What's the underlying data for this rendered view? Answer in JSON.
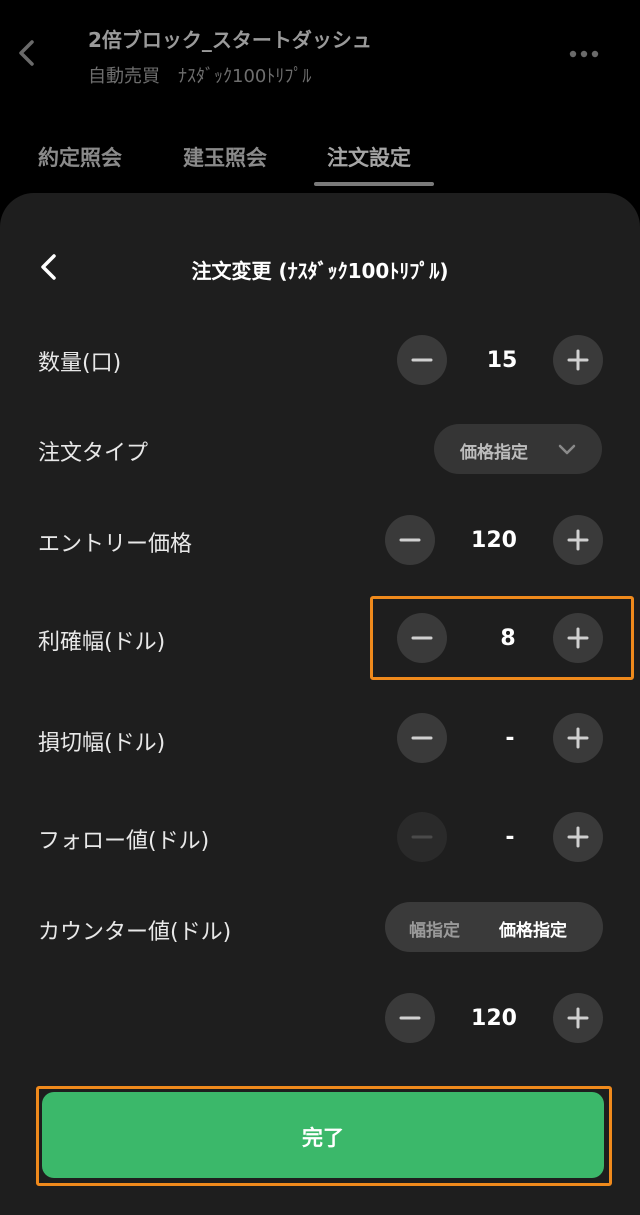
{
  "header": {
    "title": "2倍ブロック_スタートダッシュ",
    "subtitle": "自動売買　ﾅｽﾀﾞｯｸ100ﾄﾘﾌﾟﾙ",
    "tabs": [
      {
        "label": "約定照会",
        "active": false
      },
      {
        "label": "建玉照会",
        "active": false
      },
      {
        "label": "注文設定",
        "active": true
      }
    ]
  },
  "sheet": {
    "title": "注文変更 (ﾅｽﾀﾞｯｸ100ﾄﾘﾌﾟﾙ)",
    "rows": {
      "quantity": {
        "label": "数量(口)",
        "value": "15"
      },
      "order_type": {
        "label": "注文タイプ",
        "selected": "価格指定"
      },
      "entry_price": {
        "label": "エントリー価格",
        "value": "120"
      },
      "take_profit": {
        "label": "利確幅(ドル)",
        "value": "8"
      },
      "stop_loss": {
        "label": "損切幅(ドル)",
        "value": "-"
      },
      "follow": {
        "label": "フォロー値(ドル)",
        "value": "-"
      },
      "counter": {
        "label": "カウンター値(ドル)",
        "options": [
          "幅指定",
          "価格指定"
        ],
        "selected": "価格指定",
        "value": "120"
      }
    },
    "done_label": "完了"
  },
  "colors": {
    "accent_green": "#3bb86a",
    "highlight_orange": "#f08a1c",
    "sheet_bg": "#1e1e1e"
  }
}
